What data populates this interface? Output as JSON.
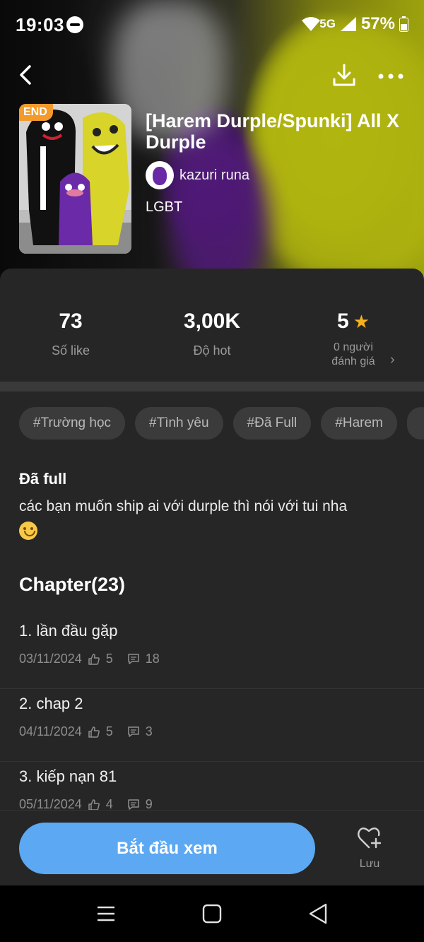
{
  "status_bar": {
    "time": "19:03",
    "network": "5G",
    "battery": "57%"
  },
  "story": {
    "end_badge": "END",
    "title": "[Harem Durple/Spunki] All X Durple",
    "author": "kazuri runa",
    "genre": "LGBT"
  },
  "stats": {
    "likes_value": "73",
    "likes_label": "Số like",
    "hot_value": "3,00K",
    "hot_label": "Độ hot",
    "rating_value": "5",
    "rating_label": "0 người đánh giá"
  },
  "tags": [
    "#Trường học",
    "#Tình yêu",
    "#Đã Full",
    "#Harem"
  ],
  "description": {
    "title": "Đã full",
    "text": "các bạn muốn ship ai với durple thì nói với tui nha"
  },
  "chapters": {
    "heading": "Chapter(23)",
    "items": [
      {
        "title": "1. lần đầu gặp",
        "date": "03/11/2024",
        "likes": "5",
        "comments": "18"
      },
      {
        "title": "2. chap 2",
        "date": "04/11/2024",
        "likes": "5",
        "comments": "3"
      },
      {
        "title": "3. kiếp nạn 81",
        "date": "05/11/2024",
        "likes": "4",
        "comments": "9"
      }
    ]
  },
  "actions": {
    "start_label": "Bắt đầu xem",
    "save_label": "Lưu"
  },
  "colors": {
    "accent": "#5ca8f2",
    "badge": "#f39a2b",
    "star": "#f6b21e",
    "panel": "#262626"
  },
  "icons": [
    "dnd-icon",
    "wifi-icon",
    "signal-icon",
    "battery-icon",
    "back-arrow-icon",
    "download-icon",
    "more-icon",
    "star-icon",
    "chevron-right-icon",
    "thumb-up-icon",
    "comment-icon",
    "heart-plus-icon",
    "nav-recents-icon",
    "nav-home-icon",
    "nav-back-icon"
  ]
}
